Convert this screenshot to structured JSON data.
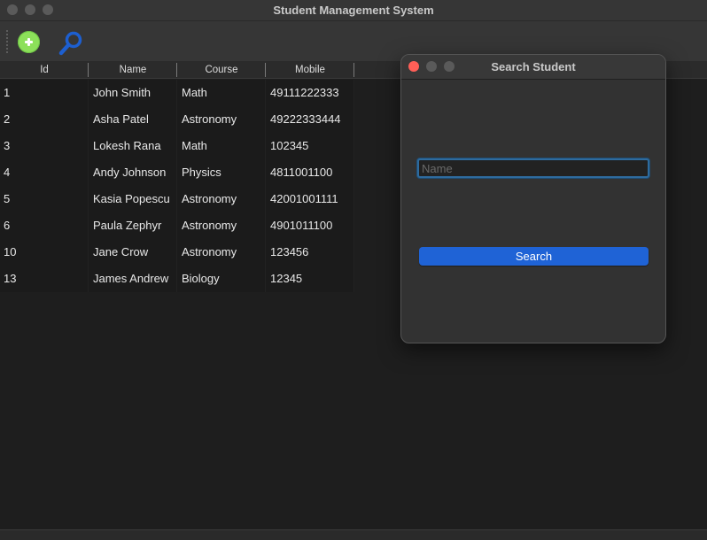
{
  "window": {
    "title": "Student Management System"
  },
  "toolbar": {
    "add_icon": "add-circle-icon",
    "search_icon": "magnifier-icon"
  },
  "table": {
    "columns": [
      "Id",
      "Name",
      "Course",
      "Mobile"
    ],
    "rows": [
      {
        "id": "1",
        "name": "John Smith",
        "course": "Math",
        "mobile": "49111222333"
      },
      {
        "id": "2",
        "name": "Asha Patel",
        "course": "Astronomy",
        "mobile": "49222333444"
      },
      {
        "id": "3",
        "name": "Lokesh Rana",
        "course": "Math",
        "mobile": "102345"
      },
      {
        "id": "4",
        "name": "Andy Johnson",
        "course": "Physics",
        "mobile": "4811001100"
      },
      {
        "id": "5",
        "name": "Kasia Popescu",
        "course": "Astronomy",
        "mobile": "42001001111"
      },
      {
        "id": "6",
        "name": "Paula Zephyr",
        "course": "Astronomy",
        "mobile": "4901011100"
      },
      {
        "id": "10",
        "name": "Jane Crow",
        "course": "Astronomy",
        "mobile": "123456"
      },
      {
        "id": "13",
        "name": "James Andrew",
        "course": "Biology",
        "mobile": "12345"
      }
    ]
  },
  "dialog": {
    "title": "Search Student",
    "name_value": "",
    "name_placeholder": "Name",
    "search_label": "Search"
  },
  "colors": {
    "accent": "#1f63d6",
    "add_green": "#8ce05a",
    "search_blue": "#1d5fd0",
    "close_red": "#ff5f57"
  }
}
